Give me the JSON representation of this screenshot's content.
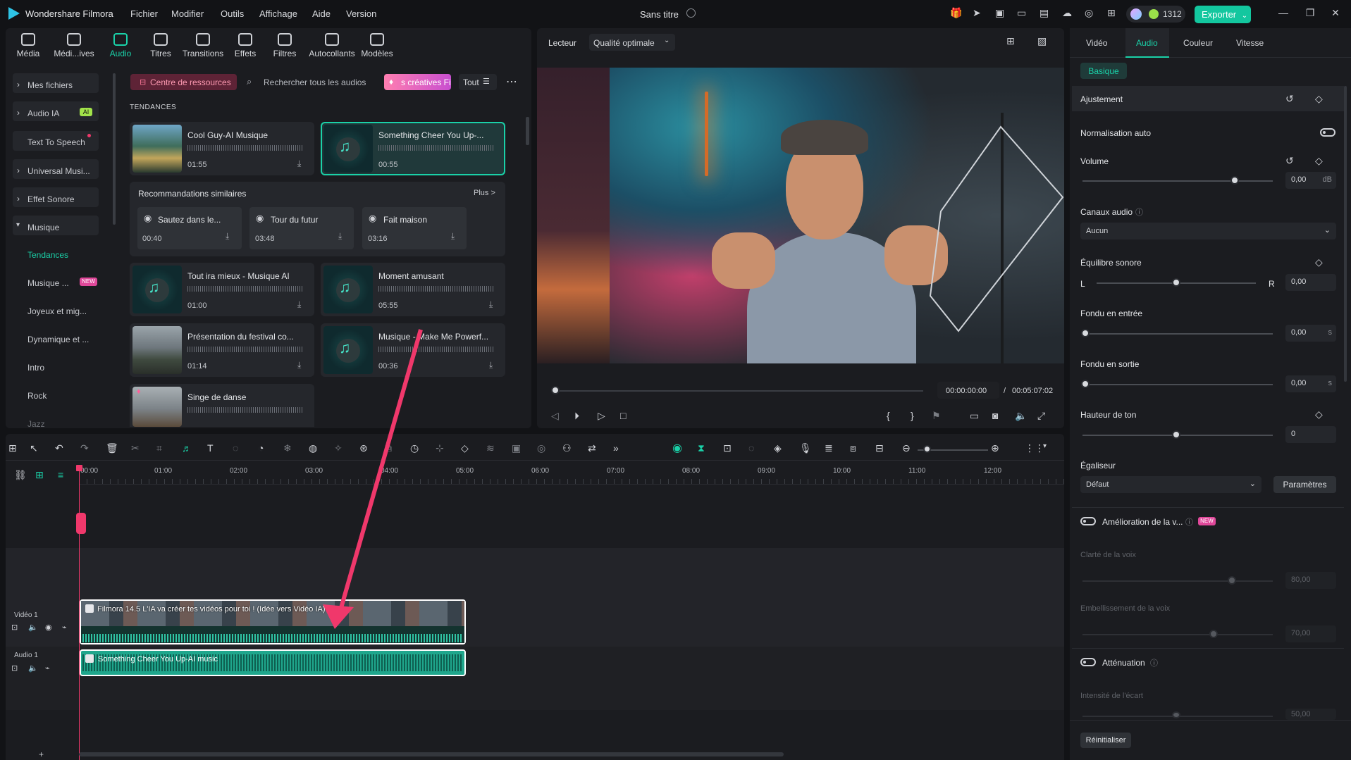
{
  "app": {
    "name": "Wondershare Filmora",
    "doc_title": "Sans titre",
    "coins": "1312",
    "export_label": "Exporter"
  },
  "menu": [
    "Fichier",
    "Modifier",
    "Outils",
    "Affichage",
    "Aide",
    "Version"
  ],
  "toolbar": [
    {
      "label": "Média",
      "icon": "media-icon"
    },
    {
      "label": "Médi...ives",
      "icon": "stock-media-icon"
    },
    {
      "label": "Audio",
      "icon": "music-note-icon"
    },
    {
      "label": "Titres",
      "icon": "titles-icon"
    },
    {
      "label": "Transitions",
      "icon": "transitions-icon"
    },
    {
      "label": "Effets",
      "icon": "effects-icon"
    },
    {
      "label": "Filtres",
      "icon": "filters-icon"
    },
    {
      "label": "Autocollants",
      "icon": "stickers-icon"
    },
    {
      "label": "Modèles",
      "icon": "templates-icon"
    }
  ],
  "sidebar": {
    "items": [
      "Mes fichiers",
      "Audio IA",
      "Text To Speech",
      "Universal Musi...",
      "Effet Sonore",
      "Musique"
    ],
    "sub": [
      "Tendances",
      "Musique ...",
      "Joyeux et mig...",
      "Dynamique et ...",
      "Intro",
      "Rock",
      "Jazz"
    ],
    "ai_badge": "AI",
    "new_badge": "NEW"
  },
  "library": {
    "resource_center": "Centre de ressources",
    "search_placeholder": "Rechercher tous les audios",
    "creative_btn": "s créatives Fi",
    "filter": "Tout",
    "section": "TENDANCES",
    "similar_title": "Recommandations similaires",
    "more": "Plus >",
    "cards": [
      {
        "title": "Cool Guy-AI Musique",
        "dur": "01:55"
      },
      {
        "title": "Something Cheer You Up-...",
        "dur": "00:55"
      },
      {
        "title": "Tout ira mieux - Musique AI",
        "dur": "01:00"
      },
      {
        "title": "Moment amusant",
        "dur": "05:55"
      },
      {
        "title": "Présentation du festival co...",
        "dur": "01:14"
      },
      {
        "title": "Musique - Make Me Powerf...",
        "dur": "00:36"
      },
      {
        "title": "Singe de danse",
        "dur": ""
      }
    ],
    "similar": [
      {
        "title": "Sautez dans le...",
        "dur": "00:40"
      },
      {
        "title": "Tour du futur",
        "dur": "03:48"
      },
      {
        "title": "Fait maison",
        "dur": "03:16"
      }
    ]
  },
  "player": {
    "label": "Lecteur",
    "quality": "Qualité optimale",
    "time": "00:00:00:00",
    "sep": "/",
    "total": "00:05:07:02"
  },
  "timeline": {
    "ticks": [
      "00:00",
      "01:00",
      "02:00",
      "03:00",
      "04:00",
      "05:00",
      "06:00",
      "07:00",
      "08:00",
      "09:00",
      "10:00",
      "11:00",
      "12:00"
    ],
    "video_track": "Vidéo 1",
    "audio_track": "Audio 1",
    "video_clip": "Filmora 14.5 L'IA va créer tes vidéos pour toi ! (Idée vers Vidéo IA)",
    "audio_clip": "Something Cheer You Up-AI music"
  },
  "inspector": {
    "tabs": [
      "Vidéo",
      "Audio",
      "Couleur",
      "Vitesse"
    ],
    "subtab": "Basique",
    "section": "Ajustement",
    "auto_norm": "Normalisation auto",
    "volume": "Volume",
    "volume_val": "0,00",
    "volume_unit": "dB",
    "volume_level": 0.8,
    "channels": "Canaux audio",
    "channels_val": "Aucun",
    "balance": "Équilibre sonore",
    "balance_l": "L",
    "balance_r": "R",
    "balance_val": "0,00",
    "fade_in": "Fondu en entrée",
    "fade_in_val": "0,00",
    "fade_out": "Fondu en sortie",
    "fade_out_val": "0,00",
    "sec_unit": "s",
    "pitch": "Hauteur de ton",
    "pitch_val": "0",
    "eq": "Égaliseur",
    "eq_val": "Défaut",
    "eq_params": "Paramètres",
    "voice_enh": "Amélioration de la v...",
    "voice_clarity": "Clarté de la voix",
    "voice_clarity_val": "80,00",
    "voice_beauty": "Embellissement de la voix",
    "voice_beauty_val": "70,00",
    "attenuation": "Atténuation",
    "gap": "Intensité de l'écart",
    "gap_val": "50,00",
    "reset": "Réinitialiser",
    "new_badge": "NEW"
  },
  "colors": {
    "accent": "#1ad1a8",
    "arrow": "#f0386b",
    "export": "#13c79f"
  }
}
